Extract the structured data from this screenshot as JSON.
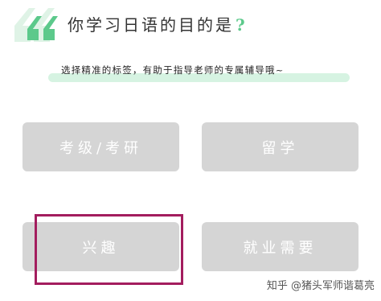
{
  "question": {
    "title": "你学习日语的目的是",
    "question_mark": "?"
  },
  "subtitle": "选择精准的标签，有助于指导老师的专属辅导哦~",
  "tags": [
    {
      "label": "考级/考研"
    },
    {
      "label": "留学"
    },
    {
      "label": "兴趣"
    },
    {
      "label": "就业需要"
    }
  ],
  "watermark": "知乎 @猪头军师谐葛亮",
  "colors": {
    "accent_green": "#5cc98b",
    "highlight_green": "#d6f3e2",
    "tag_gray": "#d5d5d5",
    "selection_border": "#a31d5e"
  },
  "icons": {
    "quote": "double-quote-icon"
  }
}
